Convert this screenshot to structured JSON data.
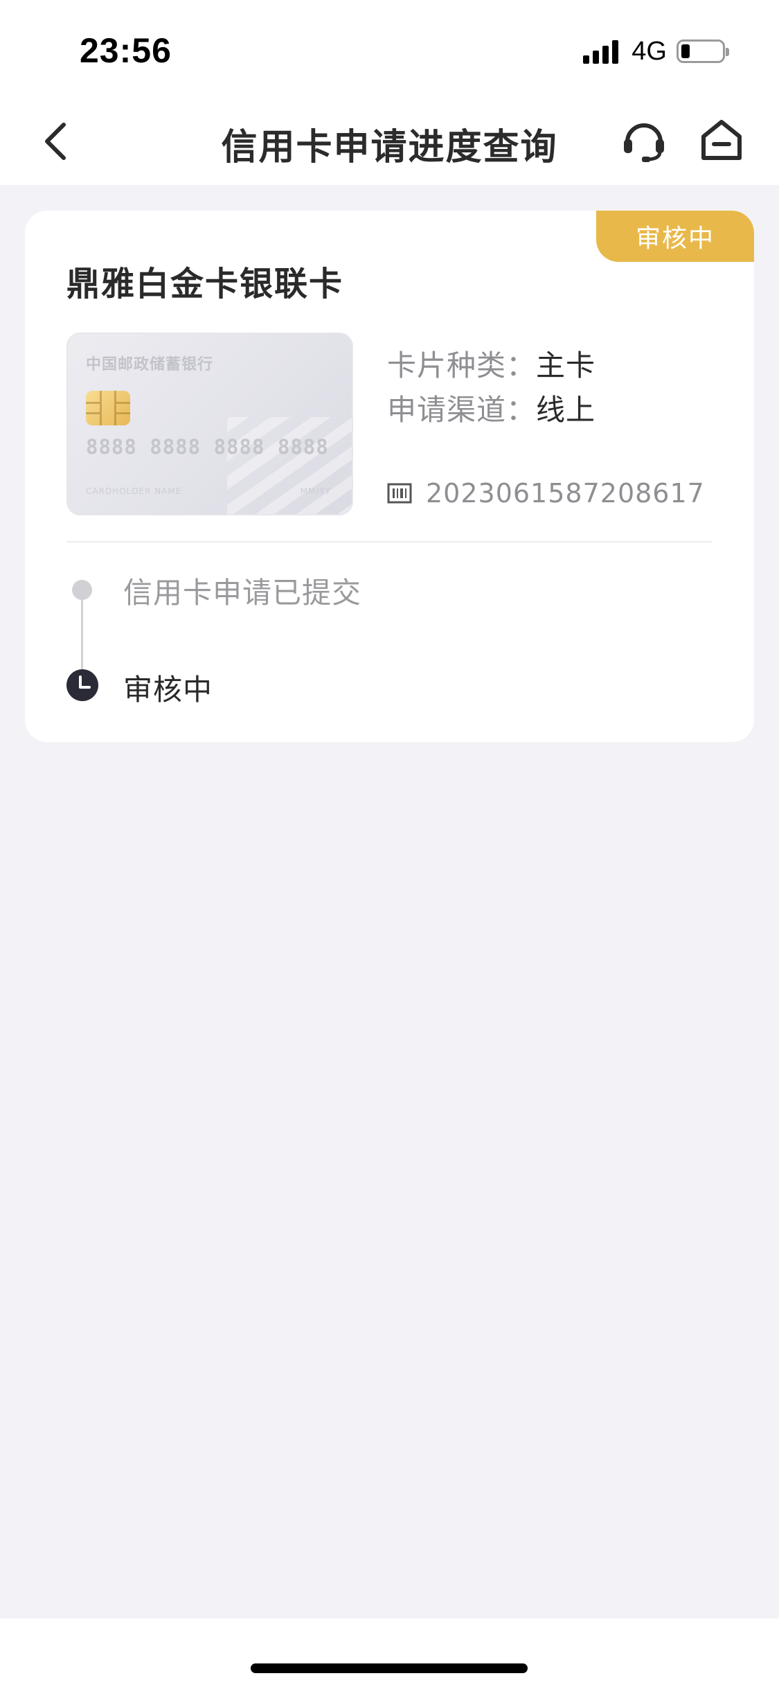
{
  "status_bar": {
    "time": "23:56",
    "network": "4G",
    "signal_icon": "signal-bars-icon",
    "battery_icon": "battery-icon",
    "battery_level": 0.15
  },
  "nav": {
    "title": "信用卡申请进度查询",
    "back_icon": "chevron-left-icon",
    "service_icon": "headset-icon",
    "home_icon": "home-icon"
  },
  "application": {
    "status_badge": "审核中",
    "card_name": "鼎雅白金卡银联卡",
    "card_image": {
      "bank_name": "中国邮政储蓄银行",
      "number": "8888 8888 8888 8888",
      "cardholder": "CARDHOLDER NAME",
      "expiry": "MM/YY"
    },
    "card_type_label": "卡片种类：",
    "card_type_value": "主卡",
    "channel_label": "申请渠道：",
    "channel_value": "线上",
    "application_id": "2023061587208617",
    "steps": [
      {
        "label": "信用卡申请已提交",
        "state": "done"
      },
      {
        "label": "审核中",
        "state": "current"
      }
    ]
  },
  "colors": {
    "badge": "#e8b94a",
    "background": "#f3f3f7",
    "title_text": "#2a2a2a",
    "muted_text": "#8e8e93"
  }
}
